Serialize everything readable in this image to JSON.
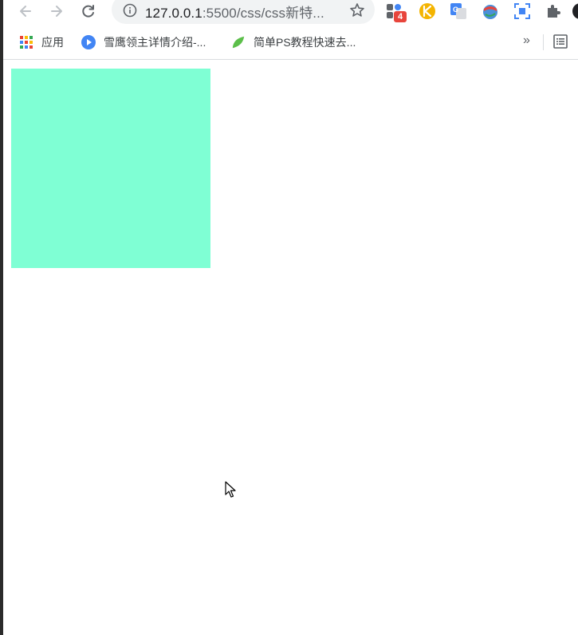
{
  "browser": {
    "address": {
      "host": "127.0.0.1",
      "path": ":5500/css/css新特..."
    },
    "extension_badge": "4",
    "bookmarks": [
      {
        "label": "应用",
        "icon": "apps-grid-icon"
      },
      {
        "label": "雪鹰领主详情介绍-...",
        "icon": "play-circle-icon"
      },
      {
        "label": "简单PS教程快速去...",
        "icon": "leaf-icon"
      }
    ],
    "overflow_label": "»"
  },
  "page": {
    "box_color": "#7fffd4"
  }
}
